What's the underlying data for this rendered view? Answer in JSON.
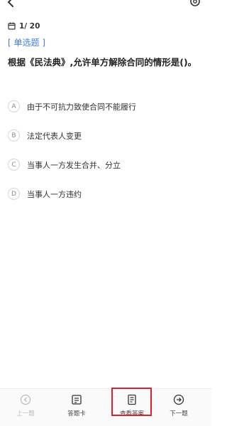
{
  "header": {
    "back_icon": "chevron-left-icon",
    "settings_icon": "gear-icon"
  },
  "progress": {
    "counter": "1/ 20",
    "calendar_icon": "calendar-icon"
  },
  "question": {
    "type_label": "[ 单选题 ]",
    "text": "根据《民法典》,允许单方解除合同的情形是()。"
  },
  "options": [
    {
      "letter": "A",
      "text": "由于不可抗力致使合同不能履行"
    },
    {
      "letter": "B",
      "text": "法定代表人变更"
    },
    {
      "letter": "C",
      "text": "当事人一方发生合并、分立"
    },
    {
      "letter": "D",
      "text": "当事人一方违约"
    }
  ],
  "bottom_nav": {
    "prev_label": "上一题",
    "card_label": "答题卡",
    "answer_label": "查看答案",
    "next_label": "下一题"
  },
  "colors": {
    "accent": "#3f7fe0",
    "highlight": "#d9202c",
    "disabled": "#bbbbbb"
  }
}
